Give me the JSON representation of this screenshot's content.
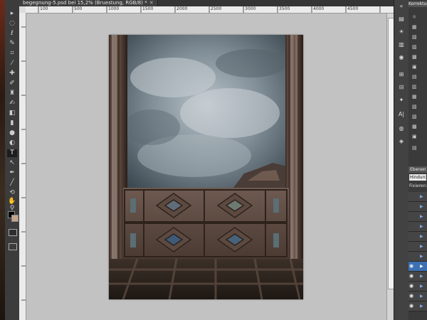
{
  "document": {
    "tab_title": "begegnung-5.psd bei 15,2% (Bruestung, RGB/8) *",
    "close_symbol": "✕"
  },
  "rulers": {
    "top_labels": [
      "100",
      "500",
      "1000",
      "1500",
      "2000",
      "2500",
      "3000",
      "3500",
      "4000",
      "4500"
    ]
  },
  "toolbar": {
    "tools": [
      "move",
      "marquee",
      "lasso",
      "quick-select",
      "crop",
      "eyedropper",
      "spot-heal",
      "brush",
      "clone-stamp",
      "history-brush",
      "eraser",
      "gradient",
      "blur",
      "dodge",
      "pen",
      "type",
      "path-select",
      "rectangle",
      "3d-rotate",
      "3d-orbit",
      "hand",
      "zoom"
    ],
    "active_tool": "type"
  },
  "panels": {
    "adjustments_tab": "Korrektur",
    "layers_tab": "Ebenen",
    "blend_mode": "Hindurch",
    "lock_label": "Fixieren:"
  },
  "colors": {
    "foreground": "#000000",
    "background": "#c4a48a",
    "selection": "#3d6fb3"
  }
}
